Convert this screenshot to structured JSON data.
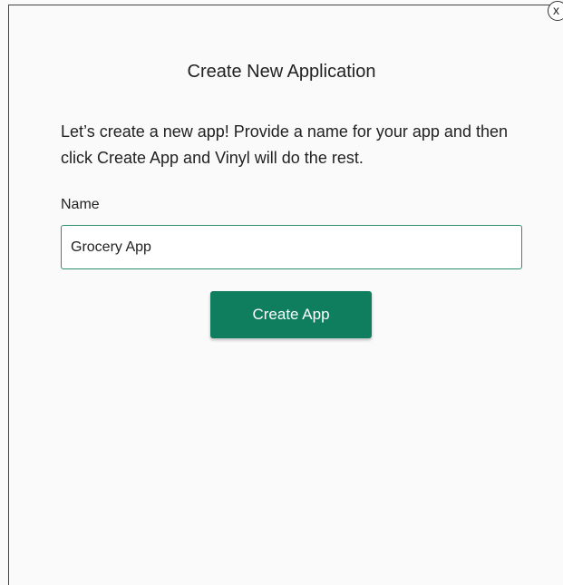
{
  "dialog": {
    "close_label": "x",
    "title": "Create New Application",
    "description": "Let’s create a new app! Provide a name for your app and then click Create App and Vinyl will do the rest.",
    "name_label": "Name",
    "name_value": "Grocery App",
    "create_button_label": "Create App"
  },
  "colors": {
    "accent": "#0f7e5e",
    "input_border": "#2e8f6d",
    "background": "#fafafa"
  },
  "icons": {
    "close": "close-icon"
  }
}
